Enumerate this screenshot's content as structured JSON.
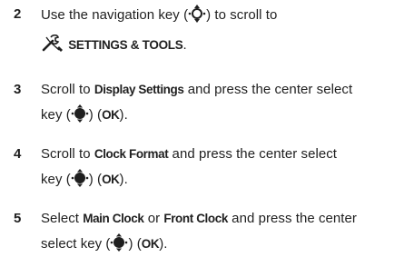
{
  "steps": [
    {
      "number": "2",
      "line1_pre": "Use the navigation key (",
      "line1_post": ") to scroll to",
      "menu_label": "SETTINGS & TOOLS",
      "menu_suffix": "."
    },
    {
      "number": "3",
      "pre": "Scroll to ",
      "target": "Display Settings",
      "mid": " and press the center select",
      "line2_pre": "key (",
      "line2_mid": ") (",
      "ok": "OK",
      "line2_post": ")."
    },
    {
      "number": "4",
      "pre": "Scroll to ",
      "target": "Clock Format",
      "mid": " and press the center select",
      "line2_pre": "key (",
      "line2_mid": ") (",
      "ok": "OK",
      "line2_post": ")."
    },
    {
      "number": "5",
      "pre": "Select ",
      "target_a": "Main Clock",
      "or": " or ",
      "target_b": "Front Clock",
      "mid": " and press the center",
      "line2_pre": "select key (",
      "line2_mid": ") (",
      "ok": "OK",
      "line2_post": ")."
    }
  ],
  "icons": {
    "navigation_key": "nav-key-icon",
    "center_select": "center-select-key-icon",
    "settings_tools": "wrench-screwdriver-icon"
  },
  "colors": {
    "text": "#1f1f1f"
  }
}
